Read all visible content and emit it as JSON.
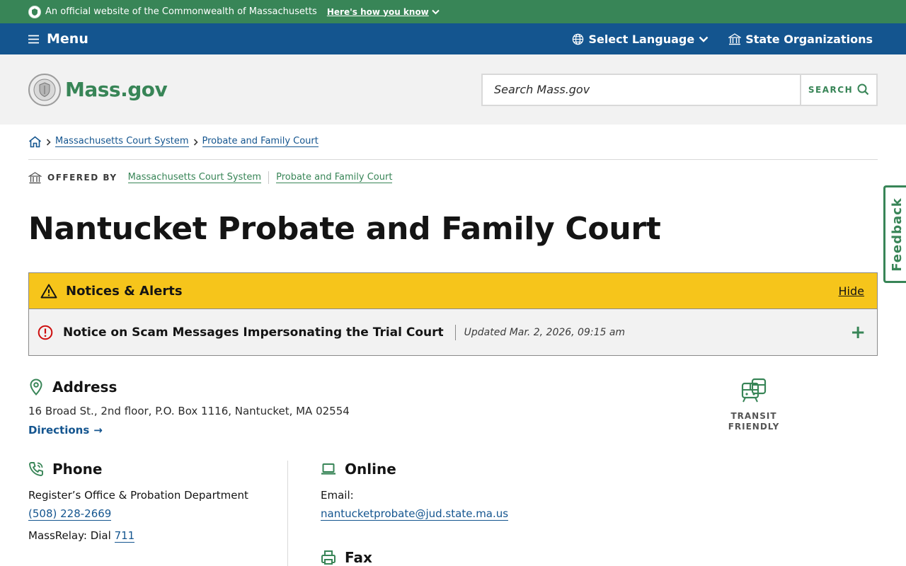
{
  "official_banner": {
    "text": "An official website of the Commonwealth of Massachusetts",
    "how_label": "Here's how you know"
  },
  "utility_nav": {
    "menu_label": "Menu",
    "language_label": "Select Language",
    "orgs_label": "State Organizations"
  },
  "header": {
    "logo_text": "Mass.gov",
    "search_placeholder": "Search Mass.gov",
    "search_button_label": "SEARCH"
  },
  "breadcrumb": [
    "Massachusetts Court System",
    "Probate and Family Court"
  ],
  "offered_by": {
    "label": "OFFERED BY",
    "links": [
      "Massachusetts Court System",
      "Probate and Family Court"
    ]
  },
  "page_title": "Nantucket Probate and Family Court",
  "alerts": {
    "heading": "Notices & Alerts",
    "hide_label": "Hide",
    "items": [
      {
        "title": "Notice on Scam Messages Impersonating the Trial Court",
        "updated": "Updated Mar. 2, 2026, 09:15 am"
      }
    ]
  },
  "address": {
    "heading": "Address",
    "line": "16 Broad St., 2nd floor, P.O. Box 1116, Nantucket, MA 02554",
    "directions_label": "Directions",
    "transit_line1": "TRANSIT",
    "transit_line2": "FRIENDLY"
  },
  "phone": {
    "heading": "Phone",
    "office": "Register’s Office & Probation Department",
    "number": "(508) 228-2669",
    "relay_prefix": "MassRelay: Dial",
    "relay_number": "711"
  },
  "online": {
    "heading": "Online",
    "email_label": "Email:",
    "email": "nantucketprobate@jud.state.ma.us"
  },
  "fax": {
    "heading": "Fax"
  },
  "feedback_label": "Feedback",
  "colors": {
    "banner_green": "#388557",
    "nav_blue": "#14558f",
    "alert_yellow": "#f6c51b",
    "link_blue": "#14558f"
  }
}
